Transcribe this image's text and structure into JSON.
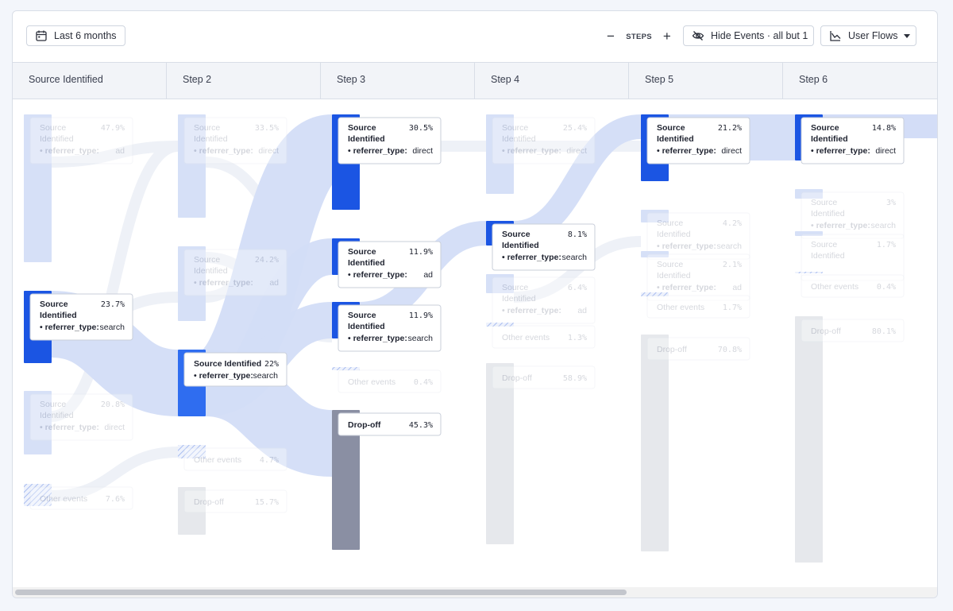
{
  "toolbar": {
    "date_range_label": "Last 6 months",
    "steps_label": "STEPS",
    "minus_symbol": "−",
    "plus_symbol": "+",
    "hide_events_label": "Hide Events · all but 1",
    "view_label": "User Flows",
    "icons": {
      "date": "calendar-icon",
      "hide": "eye-slash-icon",
      "view": "line-chart-icon",
      "caret": "caret-down-icon"
    }
  },
  "colors": {
    "highlight": "#1b55e3",
    "highlight_mid": "#2f6df0",
    "faded_node": "#d6e0f7",
    "link": "#d3ddf7",
    "dropoff_active": "#8a8fa3",
    "dropoff_faded": "#e6e8ec",
    "hatch": "#a9bdf0"
  },
  "chart_data": {
    "type": "sankey",
    "steps": [
      "Source Identified",
      "Step 2",
      "Step 3",
      "Step 4",
      "Step 5",
      "Step 6"
    ],
    "nodes": [
      {
        "id": "s1a",
        "step": 0,
        "label": "Source Identified",
        "tag": "referrer_type",
        "tag_value": "ad",
        "percent": "47.9%",
        "kind": "event",
        "active": false
      },
      {
        "id": "s1b",
        "step": 0,
        "label": "Source Identified",
        "tag": "referrer_type",
        "tag_value": "search",
        "percent": "23.7%",
        "kind": "event",
        "active": true
      },
      {
        "id": "s1c",
        "step": 0,
        "label": "Source Identified",
        "tag": "referrer_type",
        "tag_value": "direct",
        "percent": "20.8%",
        "kind": "event",
        "active": false
      },
      {
        "id": "s1o",
        "step": 0,
        "label": "Other events",
        "percent": "7.6%",
        "kind": "other",
        "active": false
      },
      {
        "id": "s2a",
        "step": 1,
        "label": "Source Identified",
        "tag": "referrer_type",
        "tag_value": "direct",
        "percent": "33.5%",
        "kind": "event",
        "active": false
      },
      {
        "id": "s2b",
        "step": 1,
        "label": "Source Identified",
        "tag": "referrer_type",
        "tag_value": "ad",
        "percent": "24.2%",
        "kind": "event",
        "active": false
      },
      {
        "id": "s2c",
        "step": 1,
        "label": "Source Identified",
        "tag": "referrer_type",
        "tag_value": "search",
        "percent": "22%",
        "kind": "event",
        "active": true
      },
      {
        "id": "s2o",
        "step": 1,
        "label": "Other events",
        "percent": "4.7%",
        "kind": "other",
        "active": false
      },
      {
        "id": "s2d",
        "step": 1,
        "label": "Drop-off",
        "percent": "15.7%",
        "kind": "dropoff",
        "active": false
      },
      {
        "id": "s3a",
        "step": 2,
        "label": "Source Identified",
        "tag": "referrer_type",
        "tag_value": "direct",
        "percent": "30.5%",
        "kind": "event",
        "active": true
      },
      {
        "id": "s3b",
        "step": 2,
        "label": "Source Identified",
        "tag": "referrer_type",
        "tag_value": "ad",
        "percent": "11.9%",
        "kind": "event",
        "active": true
      },
      {
        "id": "s3c",
        "step": 2,
        "label": "Source Identified",
        "tag": "referrer_type",
        "tag_value": "search",
        "percent": "11.9%",
        "kind": "event",
        "active": true
      },
      {
        "id": "s3o",
        "step": 2,
        "label": "Other events",
        "percent": "0.4%",
        "kind": "other",
        "active": false
      },
      {
        "id": "s3d",
        "step": 2,
        "label": "Drop-off",
        "percent": "45.3%",
        "kind": "dropoff",
        "active": true
      },
      {
        "id": "s4a",
        "step": 3,
        "label": "Source Identified",
        "tag": "referrer_type",
        "tag_value": "direct",
        "percent": "25.4%",
        "kind": "event",
        "active": false
      },
      {
        "id": "s4b",
        "step": 3,
        "label": "Source Identified",
        "tag": "referrer_type",
        "tag_value": "search",
        "percent": "8.1%",
        "kind": "event",
        "active": true
      },
      {
        "id": "s4c",
        "step": 3,
        "label": "Source Identified",
        "tag": "referrer_type",
        "tag_value": "ad",
        "percent": "6.4%",
        "kind": "event",
        "active": false
      },
      {
        "id": "s4o",
        "step": 3,
        "label": "Other events",
        "percent": "1.3%",
        "kind": "other",
        "active": false
      },
      {
        "id": "s4d",
        "step": 3,
        "label": "Drop-off",
        "percent": "58.9%",
        "kind": "dropoff",
        "active": false
      },
      {
        "id": "s5a",
        "step": 4,
        "label": "Source Identified",
        "tag": "referrer_type",
        "tag_value": "direct",
        "percent": "21.2%",
        "kind": "event",
        "active": true
      },
      {
        "id": "s5b",
        "step": 4,
        "label": "Source Identified",
        "tag": "referrer_type",
        "tag_value": "search",
        "percent": "4.2%",
        "kind": "event",
        "active": false
      },
      {
        "id": "s5c",
        "step": 4,
        "label": "Source Identified",
        "tag": "referrer_type",
        "tag_value": "ad",
        "percent": "2.1%",
        "kind": "event",
        "active": false
      },
      {
        "id": "s5o",
        "step": 4,
        "label": "Other events",
        "percent": "1.7%",
        "kind": "other",
        "active": false
      },
      {
        "id": "s5d",
        "step": 4,
        "label": "Drop-off",
        "percent": "70.8%",
        "kind": "dropoff",
        "active": false
      },
      {
        "id": "s6a",
        "step": 5,
        "label": "Source Identified",
        "tag": "referrer_type",
        "tag_value": "direct",
        "percent": "14.8%",
        "kind": "event",
        "active": true
      },
      {
        "id": "s6b",
        "step": 5,
        "label": "Source Identified",
        "tag": "referrer_type",
        "tag_value": "search",
        "percent": "3%",
        "kind": "event",
        "active": false
      },
      {
        "id": "s6c",
        "step": 5,
        "label": "Source Identified",
        "percent": "1.7%",
        "kind": "event",
        "active": false
      },
      {
        "id": "s6o",
        "step": 5,
        "label": "Other events",
        "percent": "0.4%",
        "kind": "other",
        "active": false
      },
      {
        "id": "s6d",
        "step": 5,
        "label": "Drop-off",
        "percent": "80.1%",
        "kind": "dropoff",
        "active": false
      }
    ],
    "highlighted_flows": [
      {
        "from": "s1b",
        "to": "s2c"
      },
      {
        "from": "s2c",
        "to": "s3a"
      },
      {
        "from": "s2c",
        "to": "s3b"
      },
      {
        "from": "s2c",
        "to": "s3c"
      },
      {
        "from": "s2c",
        "to": "s3d"
      },
      {
        "from": "s3c",
        "to": "s4b"
      },
      {
        "from": "s4b",
        "to": "s5a"
      },
      {
        "from": "s5a",
        "to": "s6a"
      }
    ]
  }
}
